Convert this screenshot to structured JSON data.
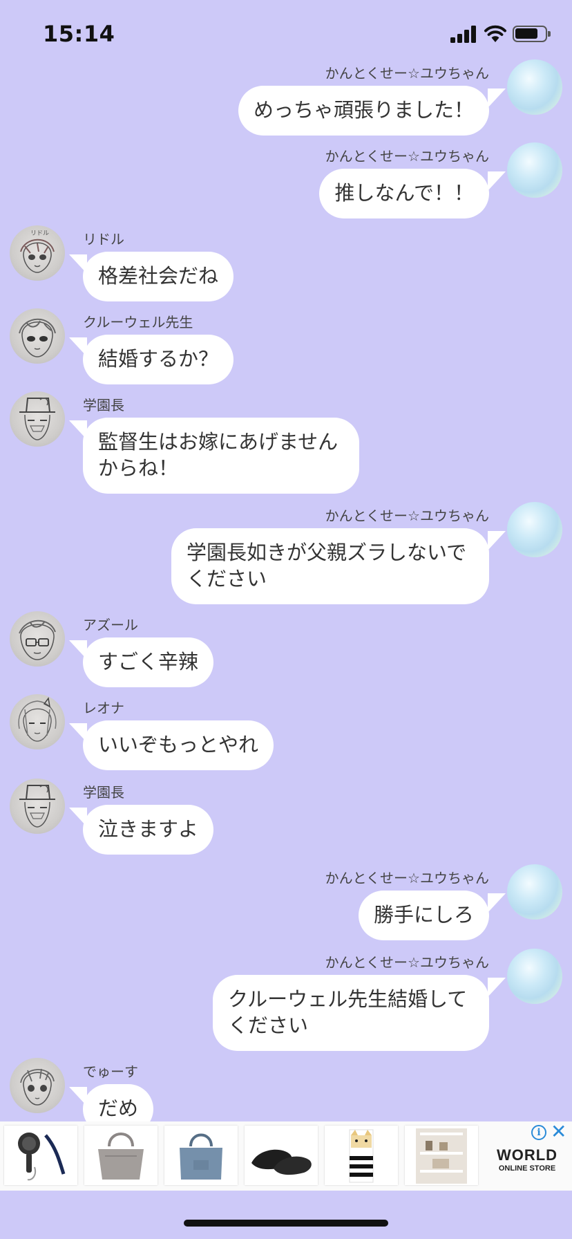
{
  "status_bar": {
    "time": "15:14"
  },
  "messages": [
    {
      "side": "right",
      "sender": "かんとくせー☆ユウちゃん",
      "lines": [
        "めっちゃ頑張りました！"
      ]
    },
    {
      "side": "right",
      "sender": "かんとくせー☆ユウちゃん",
      "lines": [
        "推しなんで！！"
      ]
    },
    {
      "side": "left",
      "sender": "リドル",
      "lines": [
        "格差社会だね"
      ]
    },
    {
      "side": "left",
      "sender": "クルーウェル先生",
      "lines": [
        "結婚するか？"
      ]
    },
    {
      "side": "left",
      "sender": "学園長",
      "lines": [
        "監督生はお嫁にあげません",
        "からね！"
      ]
    },
    {
      "side": "right",
      "sender": "かんとくせー☆ユウちゃん",
      "lines": [
        "学園長如きが父親ズラしないで",
        "ください"
      ]
    },
    {
      "side": "left",
      "sender": "アズール",
      "lines": [
        "すごく辛辣"
      ]
    },
    {
      "side": "left",
      "sender": "レオナ",
      "lines": [
        "いいぞもっとやれ"
      ]
    },
    {
      "side": "left",
      "sender": "学園長",
      "lines": [
        "泣きますよ"
      ]
    },
    {
      "side": "right",
      "sender": "かんとくせー☆ユウちゃん",
      "lines": [
        "勝手にしろ"
      ]
    },
    {
      "side": "right",
      "sender": "かんとくせー☆ユウちゃん",
      "lines": [
        "クルーウェル先生結婚して",
        "ください"
      ]
    },
    {
      "side": "left",
      "sender": "でゅーす",
      "lines": [
        "だめ"
      ]
    }
  ],
  "ad": {
    "brand": "WORLD",
    "brand_sub": "ONLINE STORE",
    "info_icon": "i",
    "close_icon": "✕",
    "items": [
      "handy-fan",
      "gray-tote-bag",
      "blue-tote-bag",
      "black-flat-shoes",
      "cat-pattern-item",
      "white-shelf"
    ]
  }
}
